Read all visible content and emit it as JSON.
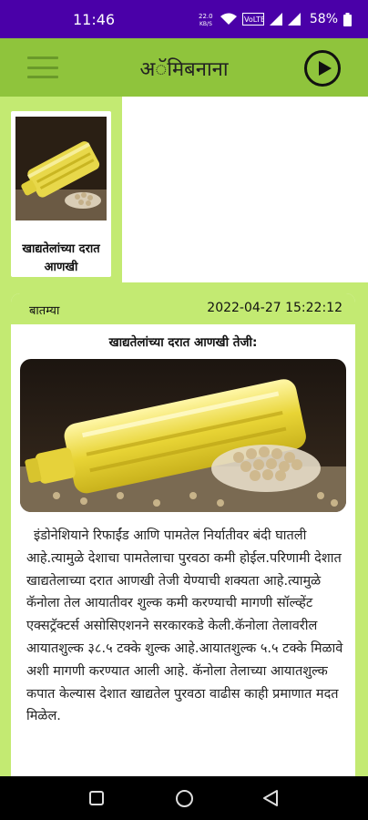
{
  "status_bar": {
    "time": "11:46",
    "speed": "22.0 KB/S",
    "volte": "VoLTE",
    "battery": "58%"
  },
  "app_bar": {
    "title": "अॅमिबनाना",
    "menu_icon": "hamburger-menu-icon",
    "play_icon": "play-circle-icon"
  },
  "thumbnails": [
    {
      "caption": "खाद्यतेलांच्या दरात आणखी",
      "image": "oil-bottle-soybeans"
    }
  ],
  "article": {
    "category": "बातम्या",
    "datetime": "2022-04-27 15:22:12",
    "title": "खाद्यतेलांच्या दरात आणखी तेजी:",
    "image": "oil-bottle-soybeans",
    "body": "इंडोनेशियाने रिफाईंड आणि पामतेल निर्यातीवर बंदी घातली आहे.त्यामुळे देशाचा पामतेलाचा पुरवठा कमी होईल.परिणामी देशात खाद्यतेलाच्या दरात आणखी तेजी येण्याची शक्यता आहे.त्यामुळे कॅनोला तेल आयातीवर शुल्क कमी करण्याची मागणी सॉल्व्हेंट एक्सट्रॅक्टर्स असोसिएशनने सरकारकडे केली.कॅनोला तेलावरील आयातशुल्क ३८.५ टक्के शुल्क आहे.आयातशुल्क ५.५ टक्के मिळावे अशी मागणी करण्यात आली आहे. कॅनोला तेलाच्या आयातशुल्क कपात केल्यास देशात खाद्यतेल पुरवठा वाढीस काही प्रमाणात मदत मिळेल."
  },
  "colors": {
    "status_bar": "#4a00a8",
    "app_bar": "#8fc43c",
    "light_green": "#c3ea72"
  },
  "nav_bar": {
    "recents_icon": "recents-square-icon",
    "home_icon": "home-circle-icon",
    "back_icon": "back-triangle-icon"
  }
}
